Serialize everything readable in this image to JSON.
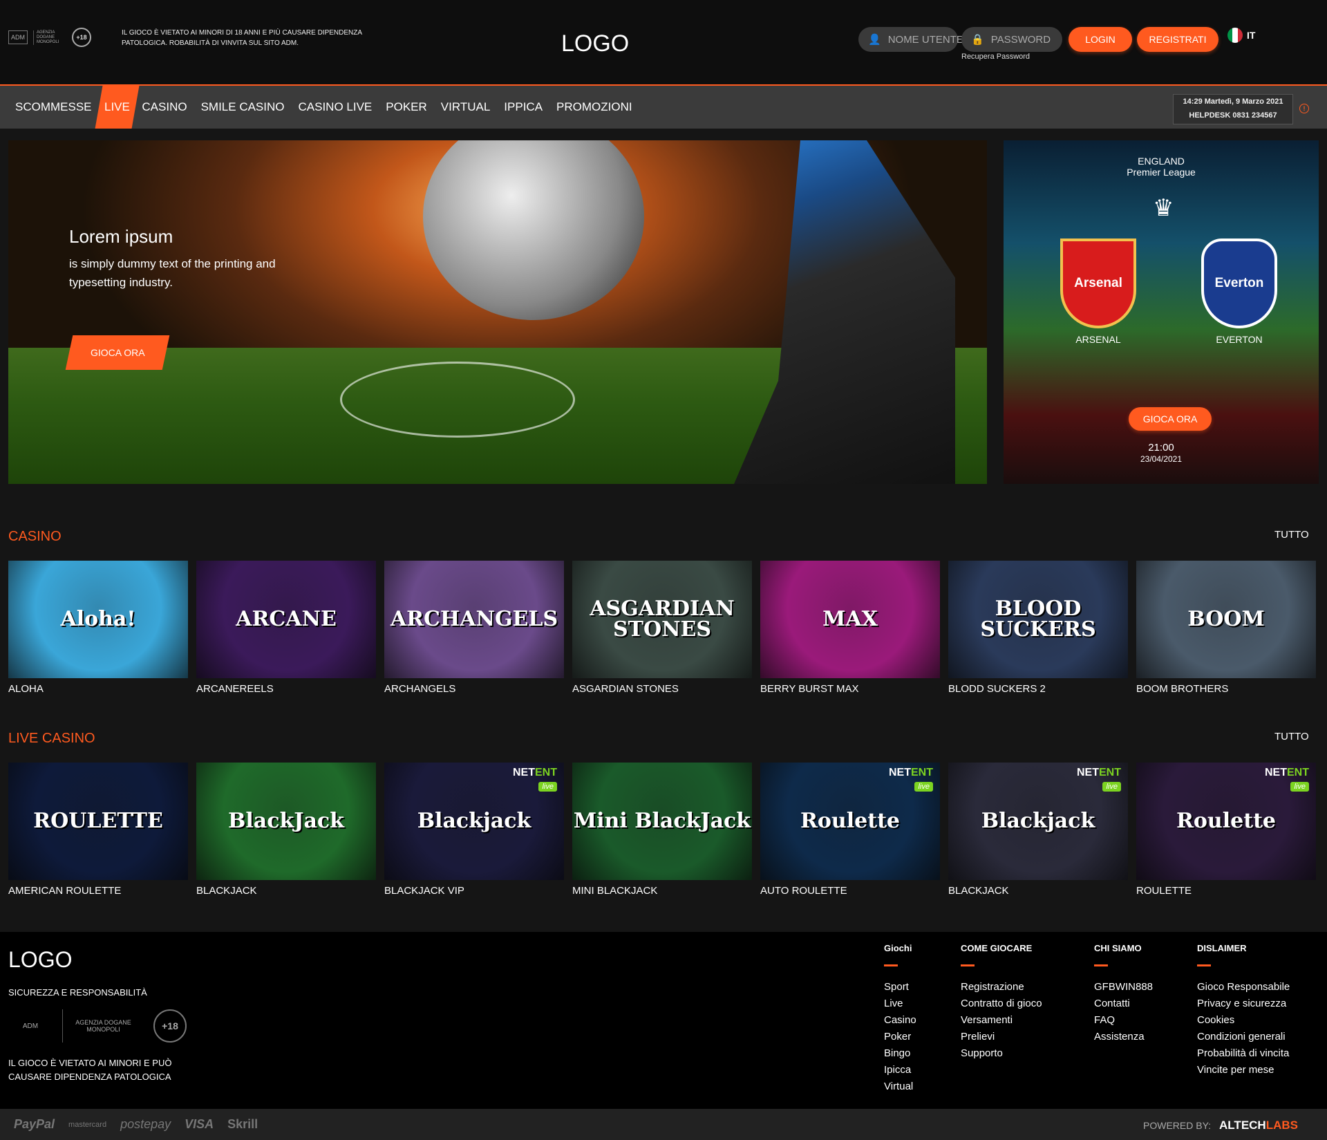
{
  "header": {
    "adm_badge": "ADM",
    "agency": "AGENZIA DOGANE MONOPOLI",
    "age_badge": "+18",
    "warning": "IL GIOCO È VIETATO AI MINORI DI 18 ANNI E PIÙ CAUSARE DIPENDENZA PATOLOGICA. ROBABILITÀ DI VINVITA SUL SITO ADM.",
    "logo": "LOGO",
    "username_placeholder": "NOME UTENTE",
    "password_placeholder": "PASSWORD",
    "login": "LOGIN",
    "register": "REGISTRATI",
    "recover": "Recupera Password",
    "language": "IT"
  },
  "nav": {
    "items": [
      "SCOMMESSE",
      "LIVE",
      "CASINO",
      "SMILE CASINO",
      "CASINO LIVE",
      "POKER",
      "VIRTUAL",
      "IPPICA",
      "PROMOZIONI"
    ],
    "active": "LIVE",
    "datetime": "14:29 Martedì, 9 Marzo 2021",
    "helpdesk": "HELPDESK 0831 234567"
  },
  "hero": {
    "title": "Lorem ipsum",
    "subtitle": "is simply dummy text of the printing and typesetting industry.",
    "cta": "GIOCA ORA"
  },
  "match": {
    "country": "ENGLAND",
    "league": "Premier League",
    "home": "ARSENAL",
    "away": "EVERTON",
    "home_crest": "Arsenal",
    "away_crest": "Everton",
    "cta": "GIOCA ORA",
    "time": "21:00",
    "date": "23/04/2021"
  },
  "casino": {
    "title": "CASINO",
    "all": "TUTTO",
    "games": [
      {
        "label": "ALOHA",
        "art": "Aloha!",
        "bg": "#3aa6d8"
      },
      {
        "label": "ARCANEREELS",
        "art": "ARCANE",
        "bg": "#3b1a5a"
      },
      {
        "label": "ARCHANGELS",
        "art": "ARCHANGELS",
        "bg": "#6a4a8a"
      },
      {
        "label": "ASGARDIAN STONES",
        "art": "ASGARDIAN STONES",
        "bg": "#3a4a44"
      },
      {
        "label": "BERRY BURST MAX",
        "art": "MAX",
        "bg": "#9a1a7a"
      },
      {
        "label": "BLODD SUCKERS 2",
        "art": "BLOOD SUCKERS",
        "bg": "#2a3a5a"
      },
      {
        "label": "BOOM BROTHERS",
        "art": "BOOM",
        "bg": "#4a5a6a"
      }
    ]
  },
  "live_casino": {
    "title": "LIVE CASINO",
    "all": "TUTTO",
    "games": [
      {
        "label": "AMERICAN ROULETTE",
        "art": "ROULETTE",
        "bg": "#0e1a3a",
        "netent": false
      },
      {
        "label": "BLACKJACK",
        "art": "BlackJack",
        "bg": "#1f6a2a",
        "netent": false
      },
      {
        "label": "BLACKJACK VIP",
        "art": "Blackjack",
        "bg": "#1a1a3a",
        "netent": true
      },
      {
        "label": "MINI BLACKJACK",
        "art": "Mini BlackJack",
        "bg": "#1a5a2a",
        "netent": false
      },
      {
        "label": "AUTO ROULETTE",
        "art": "Roulette",
        "bg": "#0e2a4a",
        "netent": true
      },
      {
        "label": "BLACKJACK",
        "art": "Blackjack",
        "bg": "#2a2a3a",
        "netent": true
      },
      {
        "label": "ROULETTE",
        "art": "Roulette",
        "bg": "#2a1a3a",
        "netent": true
      }
    ],
    "provider_a": "NET",
    "provider_b": "ENT",
    "live_tag": "live"
  },
  "footer": {
    "logo": "LOGO",
    "safety": "SICUREZZA E RESPONSABILITÀ",
    "warning": "IL GIOCO È VIETATO AI MINORI E PUÒ CAUSARE DIPENDENZA PATOLOGICA",
    "columns": [
      {
        "title": "Giochi",
        "links": [
          "Sport",
          "Live",
          "Casino",
          "Poker",
          "Bingo",
          "Ipicca",
          "Virtual"
        ]
      },
      {
        "title": "COME GIOCARE",
        "links": [
          "Registrazione",
          "Contratto di gioco",
          "Versamenti",
          "Prelievi",
          "Supporto"
        ]
      },
      {
        "title": "CHI SIAMO",
        "links": [
          "GFBWIN888",
          "Contatti",
          "FAQ",
          "Assistenza"
        ]
      },
      {
        "title": "DISLAIMER",
        "links": [
          "Gioco Responsabile",
          "Privacy e sicurezza",
          "Cookies",
          "Condizioni generali",
          "Probabilità di vincita",
          "Vincite per mese"
        ]
      }
    ],
    "payments": [
      "PayPal",
      "mastercard",
      "postepay",
      "VISA",
      "Skrill"
    ],
    "powered_by": "POWERED BY:",
    "brand_a": "ALTECH",
    "brand_b": "LABS"
  },
  "colors": {
    "accent": "#ff5a1f",
    "nav_bg": "#3b3b3b",
    "page_bg": "#151515"
  }
}
